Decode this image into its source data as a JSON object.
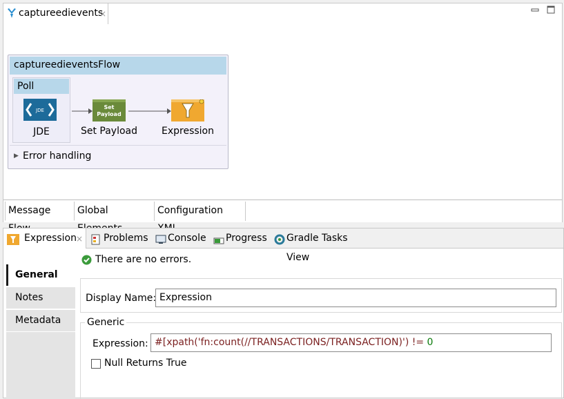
{
  "editor": {
    "tab_title": "captureedievents",
    "tab_close": "×",
    "minimize": "▭",
    "maximize": "☐",
    "flow": {
      "title": "captureedieventsFlow",
      "poll_label": "Poll",
      "nodes": {
        "jde_label": "JDE",
        "jde_icon_text": "JDE",
        "setpayload_label": "Set Payload",
        "setpayload_icon_text": "Set Payload",
        "expression_label": "Expression"
      },
      "error_handling": "Error handling"
    },
    "bottom_tabs": [
      "Message Flow",
      "Global Elements",
      "Configuration XML"
    ]
  },
  "lower": {
    "tabs": [
      "Expression",
      "Problems",
      "Console",
      "Progress",
      "Gradle Tasks View"
    ],
    "tab_close": "×",
    "status": "There are no errors.",
    "side_items": [
      "General",
      "Notes",
      "Metadata"
    ],
    "display_name_label": "Display Name:",
    "display_name_value": "Expression",
    "generic_legend": "Generic",
    "expression_label": "Expression:",
    "expression_value_main": "#[xpath('fn:count(//TRANSACTIONS/TRANSACTION)') != ",
    "expression_value_num": "0",
    "null_returns_label": "Null Returns True",
    "null_returns_checked": false
  },
  "colors": {
    "header_blue": "#b7d7ea",
    "set_payload_green": "#6a8a3a",
    "expression_orange": "#f0a830",
    "jde_blue": "#1d6b9a",
    "expr_string": "#7a1f1f",
    "expr_number": "#0a7a0a",
    "ok_green": "#3b9b3b"
  }
}
